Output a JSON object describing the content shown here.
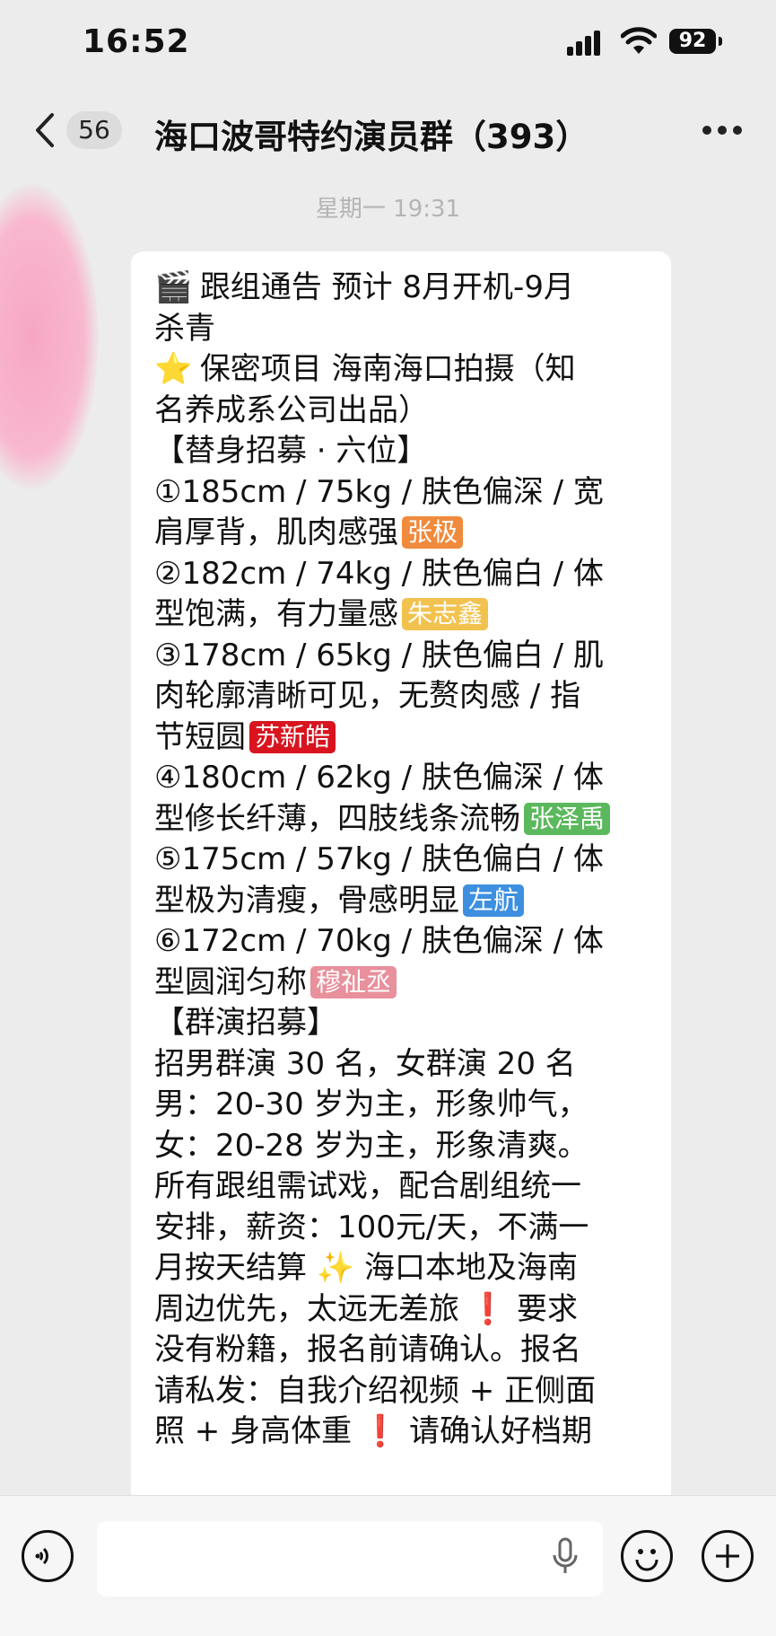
{
  "status_bar": {
    "time": "16:52",
    "battery": "92"
  },
  "header": {
    "back_count": "56",
    "title": "海口波哥特约演员群（393）"
  },
  "timestamp": "星期一 19:31",
  "message": {
    "lines": [
      {
        "emoji": "🎬",
        "text": "跟组通告 预计 8月开机-9月"
      },
      {
        "text": "杀青"
      },
      {
        "emoji": "⭐",
        "text": "保密项目 海南海口拍摄（知"
      },
      {
        "text": "名养成系公司出品）"
      },
      {
        "text": "【替身招募 · 六位】"
      },
      {
        "text": "①185cm / 75kg / 肤色偏深 / 宽"
      },
      {
        "text": "肩厚背，肌肉感强",
        "tag": "张极",
        "tag_color": "#f08a3c"
      },
      {
        "text": "②182cm / 74kg / 肤色偏白 / 体"
      },
      {
        "text": "型饱满，有力量感",
        "tag": "朱志鑫",
        "tag_color": "#f2c24f"
      },
      {
        "text": "③178cm / 65kg / 肤色偏白 / 肌"
      },
      {
        "text": "肉轮廓清晰可见，无赘肉感 / 指"
      },
      {
        "text": "节短圆",
        "tag": "苏新皓",
        "tag_color": "#d8151f"
      },
      {
        "text": "④180cm / 62kg / 肤色偏深 / 体"
      },
      {
        "text": "型修长纤薄，四肢线条流畅",
        "tag": "张泽禹",
        "tag_color": "#5cb85c"
      },
      {
        "text": "⑤175cm / 57kg / 肤色偏白 / 体"
      },
      {
        "text": "型极为清瘦，骨感明显",
        "tag": "左航",
        "tag_color": "#3d8fe0"
      },
      {
        "text": "⑥172cm / 70kg / 肤色偏深 / 体"
      },
      {
        "text": "型圆润匀称",
        "tag": "穆祉丞",
        "tag_color": "#e8909c"
      },
      {
        "text": "【群演招募】"
      },
      {
        "text": "招男群演 30 名，女群演 20 名"
      },
      {
        "text": "男：20-30 岁为主，形象帅气，"
      },
      {
        "text": "女：20-28 岁为主，形象清爽。"
      },
      {
        "text": "所有跟组需试戏，配合剧组统一"
      },
      {
        "text": "安排，薪资：100元/天，不满一"
      },
      {
        "text": "月按天结算 ✨ 海口本地及海南"
      },
      {
        "text": "周边优先，太远无差旅 ❗ 要求"
      },
      {
        "text": "没有粉籍，报名前请确认。报名"
      },
      {
        "text": "请私发：自我介绍视频 + 正侧面"
      },
      {
        "text": "照 + 身高体重 ❗ 请确认好档期"
      }
    ]
  },
  "icons": {
    "back": "chevron-left-icon",
    "more": "more-icon",
    "voice": "voice-icon",
    "mic": "mic-icon",
    "emoji": "emoji-icon",
    "plus": "plus-icon"
  }
}
